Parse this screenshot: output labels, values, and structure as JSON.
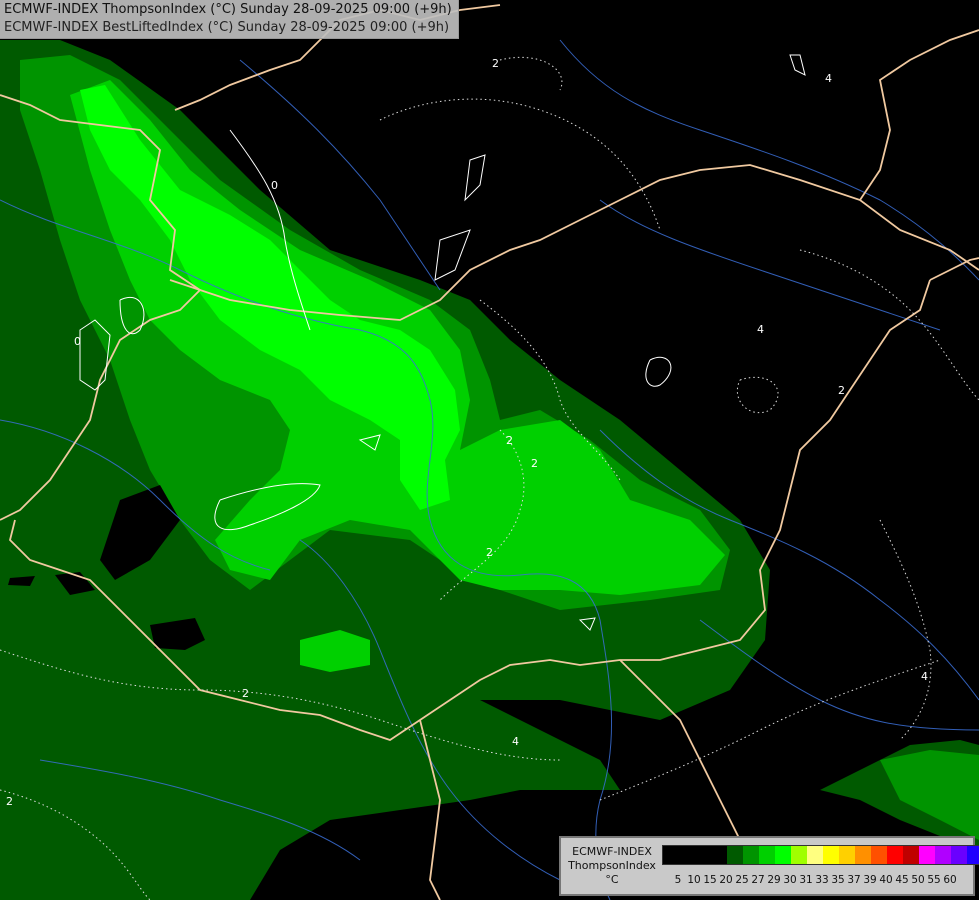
{
  "header": {
    "line1": "ECMWF-INDEX ThompsonIndex (°C) Sunday 28-09-2025 09:00 (+9h)",
    "line2": "ECMWF-INDEX BestLiftedIndex (°C) Sunday 28-09-2025 09:00 (+9h)"
  },
  "map": {
    "background": "#000000",
    "contour_labels": [
      "2",
      "0",
      "0",
      "2",
      "2",
      "2",
      "2",
      "4",
      "4",
      "4",
      "2",
      "4",
      "2"
    ],
    "fill_colors": {
      "dark": "#005a00",
      "mid": "#009400",
      "light": "#00d000",
      "bright": "#00ff00"
    }
  },
  "legend": {
    "model": "ECMWF-INDEX",
    "variable": "ThompsonIndex",
    "unit": "°C",
    "colors": [
      "#000000",
      "#000000",
      "#000000",
      "#000000",
      "#005a00",
      "#009400",
      "#00d000",
      "#00ff00",
      "#a0ff00",
      "#ffff80",
      "#ffff00",
      "#ffd000",
      "#ff9000",
      "#ff5000",
      "#ff0000",
      "#c00000",
      "#ff00ff",
      "#b000ff",
      "#6a00ff",
      "#2000ff"
    ],
    "ticks": [
      "5",
      "10",
      "15",
      "20",
      "25",
      "27",
      "29",
      "30",
      "31",
      "33",
      "35",
      "37",
      "39",
      "40",
      "45",
      "50",
      "55",
      "60"
    ]
  }
}
